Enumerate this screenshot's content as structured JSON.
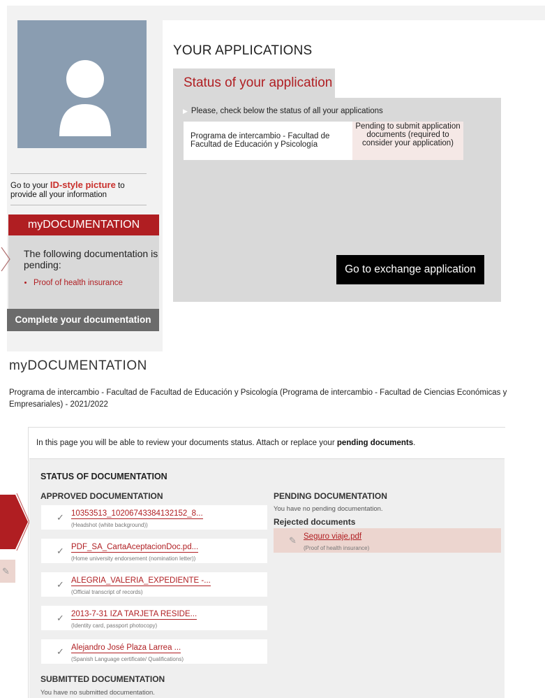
{
  "sidebar": {
    "idpic_prefix": "Go to your ",
    "idpic_highlight": "ID-style picture",
    "idpic_suffix": " to provide all your information",
    "mydoc_header": "myDOCUMENTATION",
    "pending_text": "The following documentation is pending:",
    "pending_items": [
      "Proof of health insurance"
    ],
    "complete_button": "Complete your documentation"
  },
  "applications": {
    "title": "YOUR APPLICATIONS",
    "status_tab": "Status of your application",
    "check_text": "Please, check below the status of all your applications",
    "program": "Programa de intercambio - Facultad de Facultad de Educación y Psicología",
    "status": "Pending to submit application documents (required to consider your application)",
    "exchange_button": "Go to exchange application"
  },
  "documentation": {
    "title": "myDOCUMENTATION",
    "program_text": "Programa de intercambio - Facultad de Facultad de Educación y Psicología (Programa de intercambio - Facultad de Ciencias Económicas y Empresariales) - 2021/2022",
    "intro_prefix": "In this page you will be able to review your documents status. Attach or replace your ",
    "intro_bold": "pending documents",
    "intro_suffix": ".",
    "status_heading": "STATUS OF DOCUMENTATION",
    "approved_heading": "APPROVED DOCUMENTATION",
    "approved": [
      {
        "file": "10353513_10206743384132152_8...",
        "desc": "(Headshot (white background))"
      },
      {
        "file": "PDF_SA_CartaAceptacionDoc.pd...",
        "desc": "(Home university endorsement (nomination letter))"
      },
      {
        "file": "ALEGRIA_VALERIA_EXPEDIENTE -...",
        "desc": "(Official transcript of records)"
      },
      {
        "file": "2013-7-31 IZA TARJETA RESIDE...",
        "desc": "(Identity card, passport photocopy)"
      },
      {
        "file": "Alejandro José Plaza Larrea ...",
        "desc": "(Spanish Language certificate/ Qualifications)"
      }
    ],
    "pending_heading": "PENDING DOCUMENTATION",
    "no_pending": "You have no pending documentation.",
    "rejected_heading": "Rejected documents",
    "rejected": [
      {
        "file": "Seguro viaje.pdf",
        "desc": "(Proof of health insurance)"
      }
    ],
    "submitted_heading": "SUBMITTED DOCUMENTATION",
    "no_submitted": "You have no submitted documentation."
  },
  "colors": {
    "accent": "#b01e22",
    "avatar_bg": "#8a9db1",
    "panel_grey": "#d9d9d9",
    "rejected_bg": "#ecd5cf"
  },
  "icons": {
    "avatar": "user-silhouette-icon",
    "approved_doc": "check-document-icon",
    "rejected_doc": "rejected-document-icon"
  }
}
